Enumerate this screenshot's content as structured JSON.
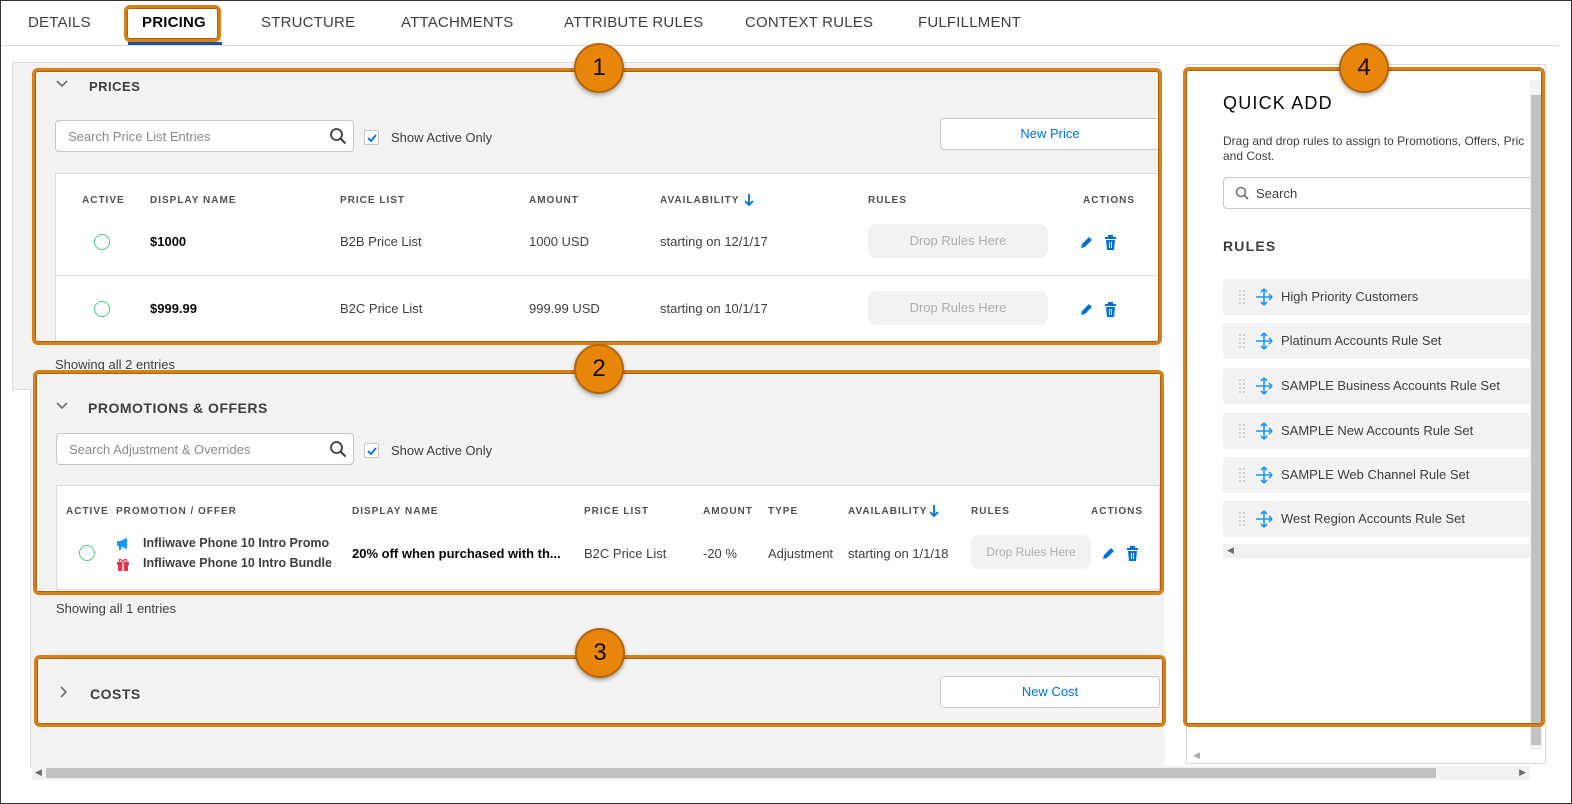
{
  "tabs": [
    "DETAILS",
    "PRICING",
    "STRUCTURE",
    "ATTACHMENTS",
    "ATTRIBUTE RULES",
    "CONTEXT RULES",
    "FULFILLMENT"
  ],
  "badges": [
    "1",
    "2",
    "3",
    "4"
  ],
  "prices": {
    "title": "PRICES",
    "search_placeholder": "Search Price List Entries",
    "show_active": "Show Active Only",
    "new_button": "New Price",
    "headers": [
      "ACTIVE",
      "DISPLAY NAME",
      "PRICE LIST",
      "AMOUNT",
      "AVAILABILITY",
      "RULES",
      "ACTIONS"
    ],
    "rows": [
      {
        "name": "$1000",
        "price_list": "B2B Price List",
        "amount": "1000 USD",
        "availability": "starting on 12/1/17",
        "drop": "Drop Rules Here"
      },
      {
        "name": "$999.99",
        "price_list": "B2C Price List",
        "amount": "999.99 USD",
        "availability": "starting on 10/1/17",
        "drop": "Drop Rules Here"
      }
    ],
    "showing": "Showing all 2 entries"
  },
  "promotions": {
    "title": "PROMOTIONS & OFFERS",
    "search_placeholder": "Search Adjustment & Overrides",
    "show_active": "Show Active Only",
    "headers": [
      "ACTIVE",
      "PROMOTION / OFFER",
      "DISPLAY NAME",
      "PRICE LIST",
      "AMOUNT",
      "TYPE",
      "AVAILABILITY",
      "RULES",
      "ACTIONS"
    ],
    "row": {
      "promo1": "Infliwave Phone 10 Intro Promo",
      "promo2": "Infliwave Phone 10 Intro Bundle",
      "name": "20% off when purchased with th...",
      "price_list": "B2C Price List",
      "amount": "-20 %",
      "type": "Adjustment",
      "availability": "starting on 1/1/18",
      "drop": "Drop Rules Here"
    },
    "showing": "Showing all 1 entries"
  },
  "costs": {
    "title": "COSTS",
    "new_button": "New Cost"
  },
  "quick_add": {
    "title": "QUICK ADD",
    "desc": "Drag and drop rules to assign to Promotions, Offers, Pric and Cost.",
    "search_placeholder": "Search",
    "rules_heading": "RULES",
    "rules": [
      "High Priority Customers",
      "Platinum Accounts Rule Set",
      "SAMPLE Business Accounts Rule Set",
      "SAMPLE New Accounts Rule Set",
      "SAMPLE Web Channel Rule Set",
      "West Region Accounts Rule Set"
    ]
  },
  "colors": {
    "accent": "#0070d2",
    "highlight": "#d4811a",
    "active": "#4bca81"
  }
}
